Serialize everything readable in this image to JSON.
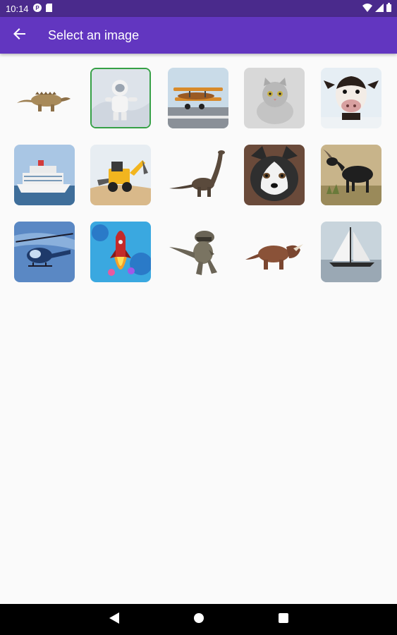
{
  "status_bar": {
    "time": "10:14",
    "left_icons": [
      "p-badge-icon",
      "sd-card-icon"
    ],
    "right_icons": [
      "wifi-icon",
      "signal-icon",
      "battery-icon"
    ]
  },
  "app_bar": {
    "title": "Select an image",
    "back_icon": "arrow-back-icon",
    "color": "#6236c0"
  },
  "images": [
    {
      "name": "ankylosaurus"
    },
    {
      "name": "astronaut",
      "selected": true
    },
    {
      "name": "biplane"
    },
    {
      "name": "cat"
    },
    {
      "name": "cow"
    },
    {
      "name": "cruise-ship"
    },
    {
      "name": "backhoe"
    },
    {
      "name": "brachiosaurus"
    },
    {
      "name": "husky"
    },
    {
      "name": "goat"
    },
    {
      "name": "helicopter"
    },
    {
      "name": "rocket"
    },
    {
      "name": "t-rex"
    },
    {
      "name": "triceratops"
    },
    {
      "name": "sailboat"
    }
  ],
  "nav_bar": {
    "buttons": [
      "back-triangle-icon",
      "home-circle-icon",
      "recents-square-icon"
    ]
  },
  "selection_color": "#36a046"
}
